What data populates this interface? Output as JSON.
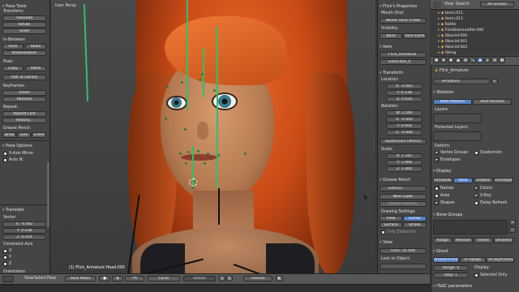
{
  "left_panel": {
    "title": "Pose Tools",
    "transform_buttons": [
      "Translate",
      "Rotate",
      "Scale"
    ],
    "in_between_label": "In-Between",
    "in_between_buttons": [
      "Push",
      "Relax",
      "Breakdowner"
    ],
    "pose_label": "Pose:",
    "pose_buttons": [
      "Copy",
      "Paste",
      "Add To Library"
    ],
    "keyframes_label": "Keyframes:",
    "keyframes_buttons": [
      "Insert",
      "Remove"
    ],
    "motion_paths_label": "Repeat:",
    "repeat_buttons": [
      "Repeat Last",
      "History..."
    ],
    "grease_pencil_label": "Grease Pencil:",
    "grease_buttons": [
      "Draw",
      "Line",
      "Erase"
    ],
    "pose_options_title": "Pose Options",
    "xaxis_mirror": "X-Axis Mirror",
    "auto_ik": "Auto IK",
    "translate_title": "Translate",
    "vector_label": "Vector",
    "vector": {
      "x": "X: -0.062",
      "y": "Y: 0.538",
      "z": "Z: 0.024"
    },
    "constraint_axis_label": "Constraint Axis",
    "constraint_axes": [
      "X",
      "Y",
      "Z"
    ],
    "orientation_label": "Orientation"
  },
  "viewport": {
    "view_label": "User Persp",
    "status_label": "(1) Flick_Armature Head.000",
    "header": {
      "menus": [
        "View",
        "Select",
        "Pose"
      ],
      "mode": "Pose Mode",
      "orientation": "Local",
      "pivot": "Closest"
    }
  },
  "properties_n": {
    "title": "Flick's Properties",
    "mouth_shut_label": "Mouth Shut",
    "mouth_shut_value": "Mouth Shut: 0.000",
    "visibility_label": "Visibility:",
    "visibility_buttons": [
      "Base",
      "Face Extra"
    ],
    "item_title": "Item",
    "item_object": "Flick_Armature",
    "item_bone": "Head.000_R",
    "transform_title": "Transform",
    "location_label": "Location:",
    "location": [
      "X: -0.062",
      "Y: 0.538",
      "Z: 0.024"
    ],
    "rotation_label": "Rotation:",
    "rotation": [
      "W: 1.000",
      "X: -0.000",
      "Y: 0.000",
      "Z: -0.000"
    ],
    "rotation_mode": "Quaternion (WXYZ)",
    "scale_label": "Scale:",
    "scale": [
      "X: 1.341",
      "Y: 1.000",
      "Z: 1.000"
    ],
    "grease_title": "Grease Pencil",
    "gpencil_name": "GPencil",
    "new_layer": "New Layer",
    "delete_frame": "Delete Frame(s)",
    "drawing_settings_label": "Drawing Settings:",
    "drawing_buttons": [
      "View",
      "Cursor",
      "Surface",
      "Stroke"
    ],
    "only_endpoints": "Only Endpoints",
    "view_title": "View",
    "lens_value": "Lens: 35.000",
    "lock_to_object": "Lock to Object:"
  },
  "outliner": {
    "view_menu": "View",
    "search_menu": "Search",
    "scenes": "All Scenes",
    "rows": [
      "Hemi.011",
      "Hemi.012",
      "Rattle",
      "FlickBakeLeaflet.000",
      "Obeclef.000",
      "Obeclef.001",
      "Obeclef.002",
      "Obing"
    ]
  },
  "properties_editor": {
    "armature_label": "Flick_Armature",
    "data_name": "Armature",
    "skeleton_title": "Skeleton",
    "position_buttons": [
      "Pose Position",
      "Rest Position"
    ],
    "layers_label": "Layers:",
    "protected_label": "Protected Layers:",
    "deform_label": "Deform:",
    "deform_items": [
      "Vertex Groups",
      "Quaternion",
      "Envelopes"
    ],
    "display_title": "Display",
    "display_types": [
      "Octahedral",
      "Stick",
      "B-Bone",
      "Envelope"
    ],
    "display_checks": [
      "Names",
      "Axes",
      "Shapes",
      "Colors",
      "X-Ray",
      "Delay Refresh"
    ],
    "bone_groups_title": "Bone Groups",
    "bone_group_buttons": [
      "Assign",
      "Remove",
      "Select",
      "Deselect"
    ],
    "ghost_title": "Ghost",
    "ghost_buttons": [
      "Around Frame",
      "In Range",
      "On Keyframes"
    ],
    "range_label": "Range: 0",
    "display_label": "Display:",
    "step_label": "Step: 1",
    "selected_only": "Selected Only",
    "ik_title": "iTaSC parameters"
  },
  "colors": {
    "accent": "#5680c2",
    "panel": "#3f3f3f",
    "bone_line": "#2ec070"
  }
}
